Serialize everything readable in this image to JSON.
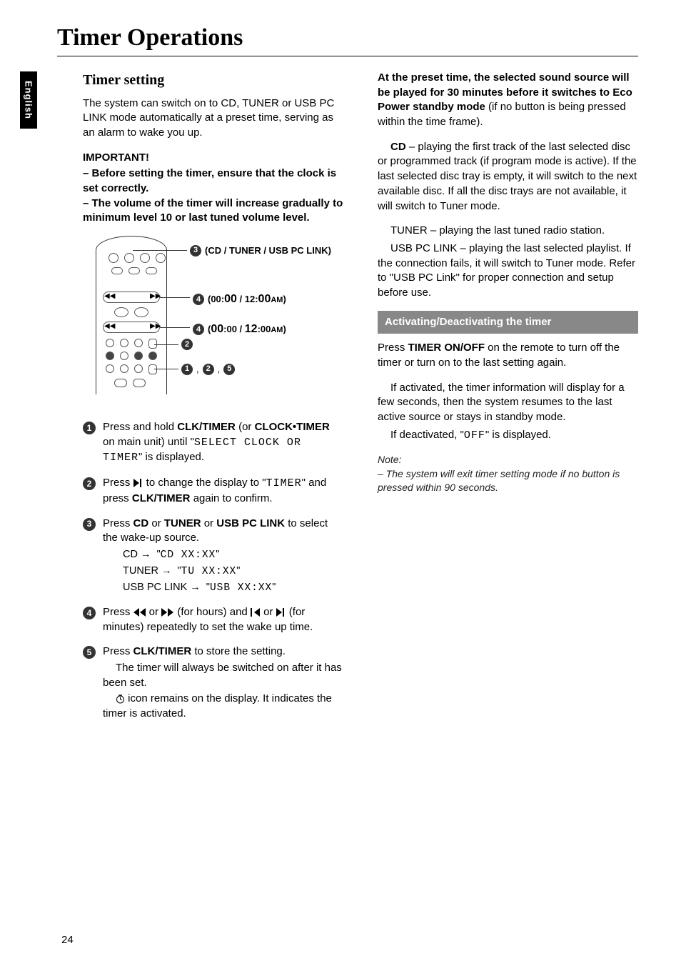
{
  "lang_tab": "English",
  "page_title": "Timer Operations",
  "left": {
    "section_heading": "Timer setting",
    "intro": "The system can switch on to CD, TUNER or USB PC LINK mode automatically at a preset time, serving as an alarm to wake you up.",
    "important_heading": "IMPORTANT!",
    "important_b1": "–  Before setting the timer, ensure that the clock is set correctly.",
    "important_b2": "–  The volume of the timer will increase gradually to minimum level 10 or last tuned volume level.",
    "diagram": {
      "label3_num": "3",
      "label3_text": "(CD / TUNER / USB PC LINK)",
      "label4a_num": "4",
      "label4a_text": "(00:00 / 12:00AM)",
      "label4b_num": "4",
      "label4b_text": "(00:00 / 12:00AM)",
      "label2_num": "2",
      "label125_text": "1, 2, 5"
    },
    "step1": {
      "pre": "Press and hold ",
      "b1": "CLK/TIMER",
      "mid": " (or ",
      "b2": "CLOCK•TIMER",
      "mid2": " on main unit) until \"",
      "seg": "SELECT CLOCK OR TIMER",
      "post": "\" is displayed."
    },
    "step2": {
      "pre": "Press ",
      "mid": " to change the display to \"",
      "seg": "TIMER",
      "mid2": "\" and press ",
      "b1": "CLK/TIMER",
      "post": " again to confirm."
    },
    "step3": {
      "pre": "Press ",
      "b1": "CD",
      "or1": " or ",
      "b2": "TUNER",
      "or2": " or ",
      "b3": "USB PC LINK",
      "post": " to select the wake-up source.",
      "l1_src": "CD",
      "l1_seg": "CD XX:XX",
      "l2_src": "TUNER",
      "l2_seg": "TU XX:XX",
      "l3_src": "USB PC LINK",
      "l3_seg": "USB XX:XX"
    },
    "step4": {
      "pre": "Press ",
      "mid1": " or ",
      "mid2": " (for hours) and ",
      "mid3": " or ",
      "post": " (for minutes) repeatedly to set the wake up time."
    },
    "step5": {
      "pre": "Press ",
      "b1": "CLK/TIMER",
      "post": " to store the setting.",
      "body2_pre": "The timer will always be switched on after it has been set.",
      "body3_post": " icon remains on the display. It indicates the timer is activated."
    }
  },
  "right": {
    "lead_bold": "At the preset time, the selected sound source will be played for 30 minutes before it switches to Eco Power standby mode",
    "lead_rest": " (if no button is being pressed within the time frame).",
    "cd_b": "CD",
    "cd_rest": " – playing the first track of the last selected disc or programmed track (if program mode is active).  If the last selected disc tray is empty, it will switch to the next available disc.  If all the disc trays are not available, it will switch to Tuner mode.",
    "tuner_b": "TUNER",
    "tuner_rest": " – playing the last tuned radio station.",
    "usb_b": "USB PC LINK",
    "usb_mid": " – playing the last selected playlist.  If the connection fails, it will switch to Tuner mode.  Refer to \"",
    "usb_b2": "USB PC Link",
    "usb_post": "\" for proper connection and setup before use.",
    "sect_heading": "Activating/Deactivating the timer",
    "act_pre": "Press ",
    "act_b": "TIMER ON/OFF",
    "act_post": " on the remote to turn off the timer or turn on to the last setting again.",
    "act_body2": "If activated, the timer information will display for a few seconds, then the system resumes to the last active source or stays in standby mode.",
    "act_body3_pre": "If deactivated, \"",
    "act_body3_seg": "OFF",
    "act_body3_post": "\" is displayed.",
    "note_head": "Note:",
    "note_body": "–  The system will exit timer setting mode if no button is pressed within 90 seconds."
  },
  "page_number": "24"
}
